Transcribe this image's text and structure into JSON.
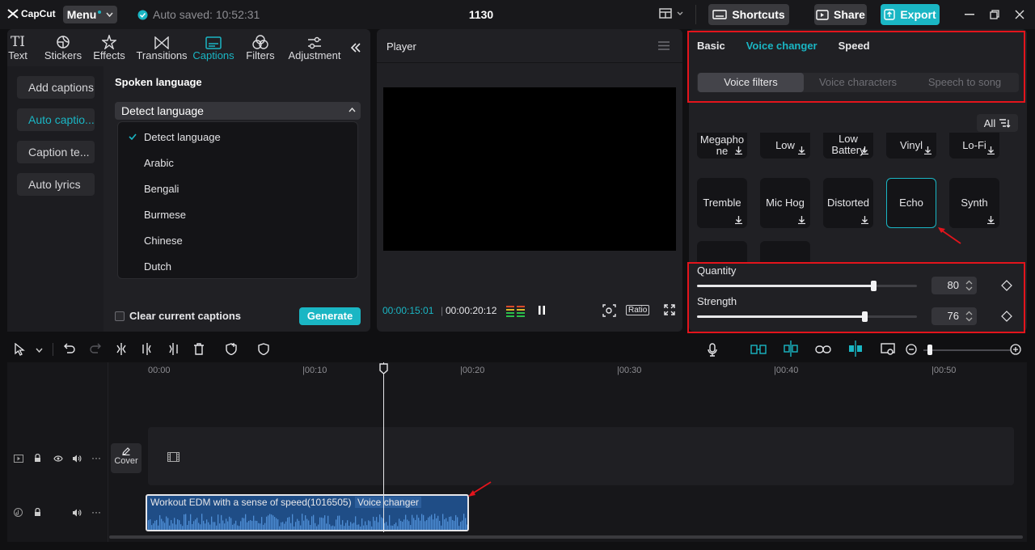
{
  "topbar": {
    "logo": "CapCut",
    "menu_label": "Menu",
    "autosave": "Auto saved: 10:52:31",
    "title": "1130",
    "shortcuts": "Shortcuts",
    "share": "Share",
    "export": "Export"
  },
  "left_panel": {
    "tabs": [
      {
        "label": "Text",
        "icon": "text-icon"
      },
      {
        "label": "Stickers",
        "icon": "sticker-icon"
      },
      {
        "label": "Effects",
        "icon": "effects-icon"
      },
      {
        "label": "Transitions",
        "icon": "transitions-icon"
      },
      {
        "label": "Captions",
        "icon": "captions-icon",
        "active": true
      },
      {
        "label": "Filters",
        "icon": "filters-icon"
      },
      {
        "label": "Adjustment",
        "icon": "adjustment-icon"
      }
    ],
    "sub_nav": [
      "Add captions",
      "Auto captio...",
      "Caption te...",
      "Auto lyrics"
    ],
    "section_title": "Spoken language",
    "selected_language": "Detect language",
    "languages": [
      "Detect language",
      "Arabic",
      "Bengali",
      "Burmese",
      "Chinese",
      "Dutch"
    ],
    "clear_label": "Clear current captions",
    "generate_label": "Generate"
  },
  "player": {
    "title": "Player",
    "current_time": "00:00:15:01",
    "total_time": "00:00:20:12",
    "ratio_label": "Ratio"
  },
  "right_panel": {
    "tabs": [
      "Basic",
      "Voice changer",
      "Speed"
    ],
    "segments": [
      "Voice filters",
      "Voice characters",
      "Speech to song"
    ],
    "all_label": "All",
    "filters_row1": [
      "Megapho\nne",
      "Low",
      "Low\nBattery",
      "Vinyl",
      "Lo-Fi"
    ],
    "filters_row2": [
      "Tremble",
      "Mic Hog",
      "Distorted",
      "Echo",
      "Synth"
    ],
    "selected_filter": "Echo",
    "quantity_label": "Quantity",
    "quantity_value": "80",
    "quantity_level": 80,
    "strength_label": "Strength",
    "strength_value": "76",
    "strength_level": 76,
    "accent": "#1ab6c4",
    "highlight": "#e3141c"
  },
  "timeline": {
    "ruler": [
      "00:00",
      "|00:10",
      "|00:20",
      "|00:30",
      "|00:40",
      "|00:50"
    ],
    "cover_label": "Cover",
    "clip_name": "Workout EDM with a sense of speed(1016505)",
    "clip_badge": "Voice changer"
  }
}
